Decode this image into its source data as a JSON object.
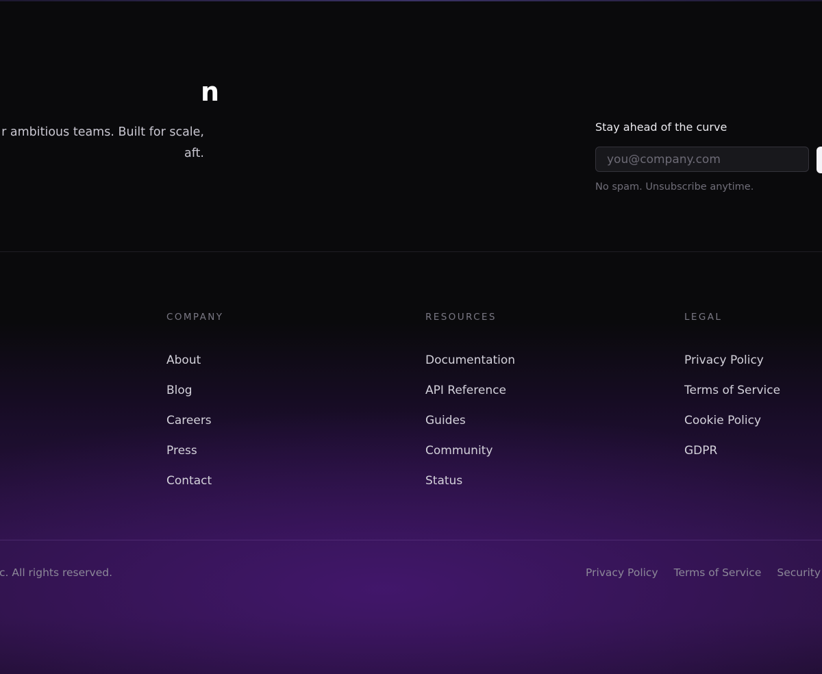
{
  "brand": {
    "title": "n",
    "tagline_line1": "r ambitious teams. Built for scale,",
    "tagline_line2": "aft."
  },
  "newsletter": {
    "heading": "Stay ahead of the curve",
    "email_placeholder": "you@company.com",
    "fineprint": "No spam. Unsubscribe anytime."
  },
  "columns": {
    "company": {
      "heading": "COMPANY",
      "links": [
        "About",
        "Blog",
        "Careers",
        "Press",
        "Contact"
      ]
    },
    "resources": {
      "heading": "RESOURCES",
      "links": [
        "Documentation",
        "API Reference",
        "Guides",
        "Community",
        "Status"
      ]
    },
    "legal": {
      "heading": "LEGAL",
      "links": [
        "Privacy Policy",
        "Terms of Service",
        "Cookie Policy",
        "GDPR"
      ]
    }
  },
  "bottom_bar": {
    "copyright": "nc. All rights reserved.",
    "links": [
      "Privacy Policy",
      "Terms of Service",
      "Security"
    ]
  },
  "colors": {
    "background": "#0a0a0c",
    "accent_glow": "#481876",
    "button": "#f4f3f7"
  }
}
